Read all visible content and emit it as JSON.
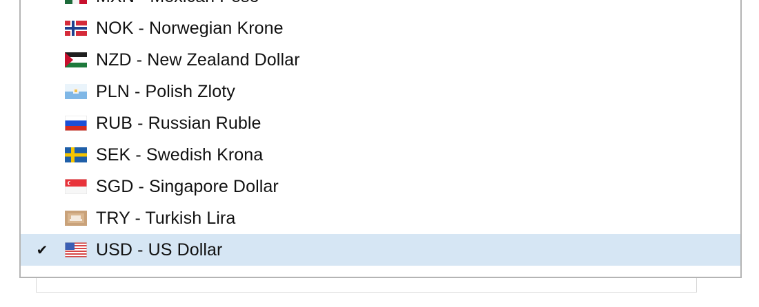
{
  "currency_dropdown": {
    "items": [
      {
        "label": "MXN - Mexican Peso",
        "flag_icon": "mexico-flag-icon",
        "selected": false
      },
      {
        "label": "NOK - Norwegian Krone",
        "flag_icon": "norway-flag-icon",
        "selected": false
      },
      {
        "label": "NZD - New Zealand Dollar",
        "flag_icon": "new-zealand-flag-icon",
        "selected": false
      },
      {
        "label": "PLN - Polish Zloty",
        "flag_icon": "poland-flag-icon",
        "selected": false
      },
      {
        "label": "RUB - Russian Ruble",
        "flag_icon": "russia-flag-icon",
        "selected": false
      },
      {
        "label": "SEK - Swedish Krona",
        "flag_icon": "sweden-flag-icon",
        "selected": false
      },
      {
        "label": "SGD - Singapore Dollar",
        "flag_icon": "singapore-flag-icon",
        "selected": false
      },
      {
        "label": "TRY - Turkish Lira",
        "flag_icon": "turkey-flag-icon",
        "selected": false
      },
      {
        "label": "USD - US Dollar",
        "flag_icon": "usa-flag-icon",
        "selected": true
      }
    ],
    "checkmark": "✔",
    "colors": {
      "selected_background": "#d6e6f4",
      "border": "#b4b4b4"
    }
  }
}
